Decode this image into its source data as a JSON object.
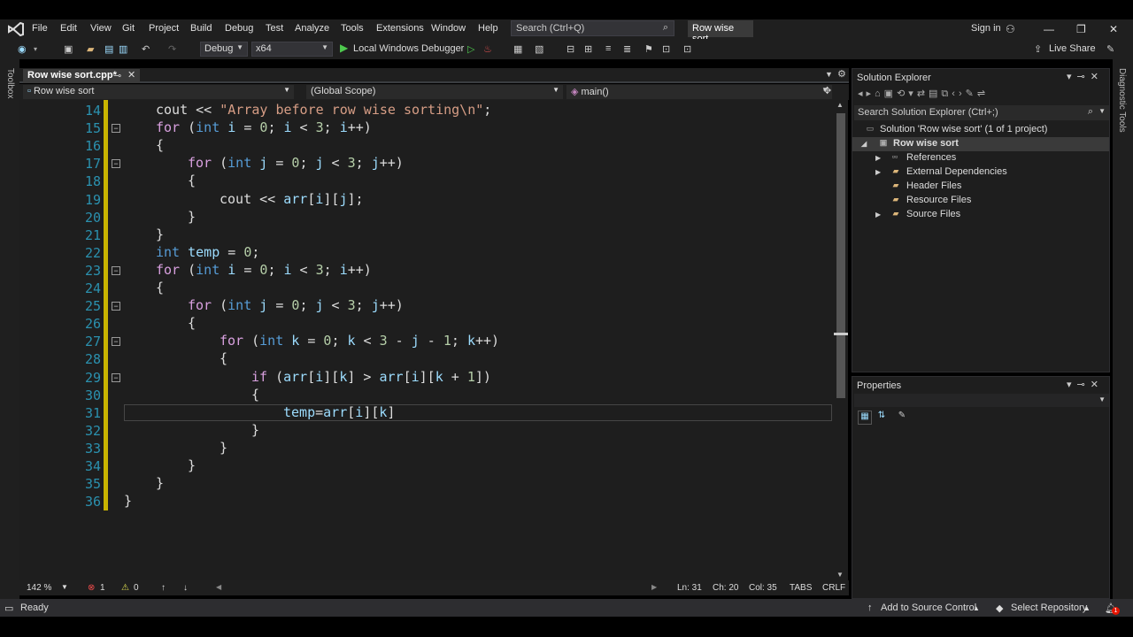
{
  "menu": [
    "File",
    "Edit",
    "View",
    "Git",
    "Project",
    "Build",
    "Debug",
    "Test",
    "Analyze",
    "Tools",
    "Extensions",
    "Window",
    "Help"
  ],
  "search": {
    "placeholder": "Search (Ctrl+Q)"
  },
  "solution_name_badge": "Row wise sort",
  "signin": "Sign in",
  "toolbar": {
    "config": "Debug",
    "platform": "x64",
    "debugger": "Local Windows Debugger",
    "live_share": "Live Share"
  },
  "side_tabs": {
    "left": "Toolbox",
    "right": "Diagnostic Tools"
  },
  "editor": {
    "tab_title": "Row wise sort.cpp*",
    "nav_project": "Row wise sort",
    "nav_scope": "(Global Scope)",
    "nav_member": "main()",
    "lines": [
      {
        "n": "14",
        "text": "cout << \"Array before row wise sorting\\n\";"
      },
      {
        "n": "15",
        "text": "for (int i = 0; i < 3; i++)"
      },
      {
        "n": "16",
        "text": "{"
      },
      {
        "n": "17",
        "text": "for (int j = 0; j < 3; j++)"
      },
      {
        "n": "18",
        "text": "{"
      },
      {
        "n": "19",
        "text": "cout << arr[i][j];"
      },
      {
        "n": "20",
        "text": "}"
      },
      {
        "n": "21",
        "text": "}"
      },
      {
        "n": "22",
        "text": "int temp = 0;"
      },
      {
        "n": "23",
        "text": "for (int i = 0; i < 3; i++)"
      },
      {
        "n": "24",
        "text": "{"
      },
      {
        "n": "25",
        "text": "for (int j = 0; j < 3; j++)"
      },
      {
        "n": "26",
        "text": "{"
      },
      {
        "n": "27",
        "text": "for (int k = 0; k < 3 - j - 1; k++)"
      },
      {
        "n": "28",
        "text": "{"
      },
      {
        "n": "29",
        "text": "if (arr[i][k] > arr[i][k + 1])"
      },
      {
        "n": "30",
        "text": "{"
      },
      {
        "n": "31",
        "text": "temp=arr[i][k]"
      },
      {
        "n": "32",
        "text": "}"
      },
      {
        "n": "33",
        "text": "}"
      },
      {
        "n": "34",
        "text": "}"
      },
      {
        "n": "35",
        "text": "}"
      },
      {
        "n": "36",
        "text": "}"
      }
    ],
    "status": {
      "zoom": "142 %",
      "errors": "1",
      "warnings": "0",
      "line": "Ln: 31",
      "char": "Ch: 20",
      "col": "Col: 35",
      "tabs": "TABS",
      "eol": "CRLF"
    }
  },
  "solution_explorer": {
    "title": "Solution Explorer",
    "search_placeholder": "Search Solution Explorer (Ctrl+;)",
    "solution_label": "Solution 'Row wise sort' (1 of 1 project)",
    "project": "Row wise sort",
    "items": [
      "References",
      "External Dependencies",
      "Header Files",
      "Resource Files",
      "Source Files"
    ]
  },
  "properties": {
    "title": "Properties"
  },
  "statusbar": {
    "ready": "Ready",
    "source_control": "Add to Source Control",
    "repo": "Select Repository",
    "notif_count": "1"
  }
}
